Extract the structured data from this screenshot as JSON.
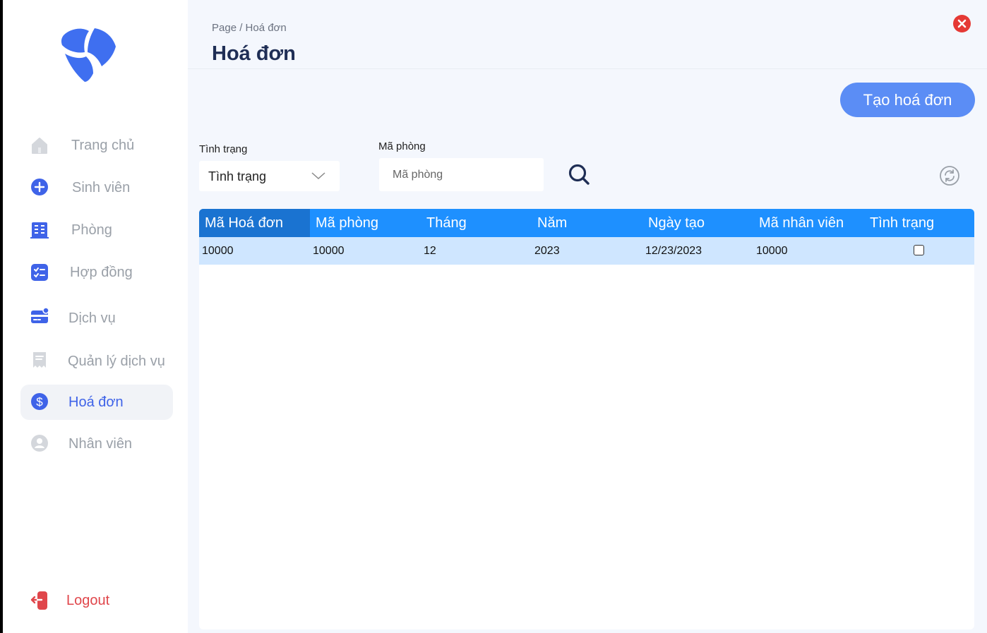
{
  "sidebar": {
    "items": [
      {
        "label": "Trang chủ",
        "icon": "home-icon"
      },
      {
        "label": "Sinh viên",
        "icon": "plus-circle-icon"
      },
      {
        "label": "Phòng",
        "icon": "building-icon"
      },
      {
        "label": "Hợp đồng",
        "icon": "checklist-icon"
      },
      {
        "label": "Dịch vụ",
        "icon": "card-icon"
      },
      {
        "label": "Quản lý dịch vụ",
        "icon": "receipt-icon"
      },
      {
        "label": "Hoá đơn",
        "icon": "dollar-icon"
      },
      {
        "label": "Nhân viên",
        "icon": "user-icon"
      }
    ],
    "active_index": 6,
    "logout_label": "Logout"
  },
  "header": {
    "breadcrumb": "Page / Hoá đơn",
    "title": "Hoá đơn"
  },
  "toolbar": {
    "create_label": "Tạo hoá đơn"
  },
  "filters": {
    "status_label": "Tình trạng",
    "status_value": "Tình trạng",
    "room_label": "Mã phòng",
    "room_placeholder": "Mã phòng",
    "room_value": ""
  },
  "table": {
    "columns": [
      "Mã Hoá đơn",
      "Mã phòng",
      "Tháng",
      "Năm",
      "Ngày tạo",
      "Mã nhân viên",
      "Tình trạng"
    ],
    "rows": [
      {
        "ma_hoa_don": "10000",
        "ma_phong": "10000",
        "thang": "12",
        "nam": "2023",
        "ngay_tao": "12/23/2023",
        "ma_nhan_vien": "10000",
        "tinh_trang": false
      }
    ]
  },
  "colors": {
    "accent": "#3f63e8",
    "header_blue": "#1e90ff",
    "row_highlight": "#cfe6ff",
    "create_button": "#5b8df5",
    "logout": "#e0464b"
  }
}
